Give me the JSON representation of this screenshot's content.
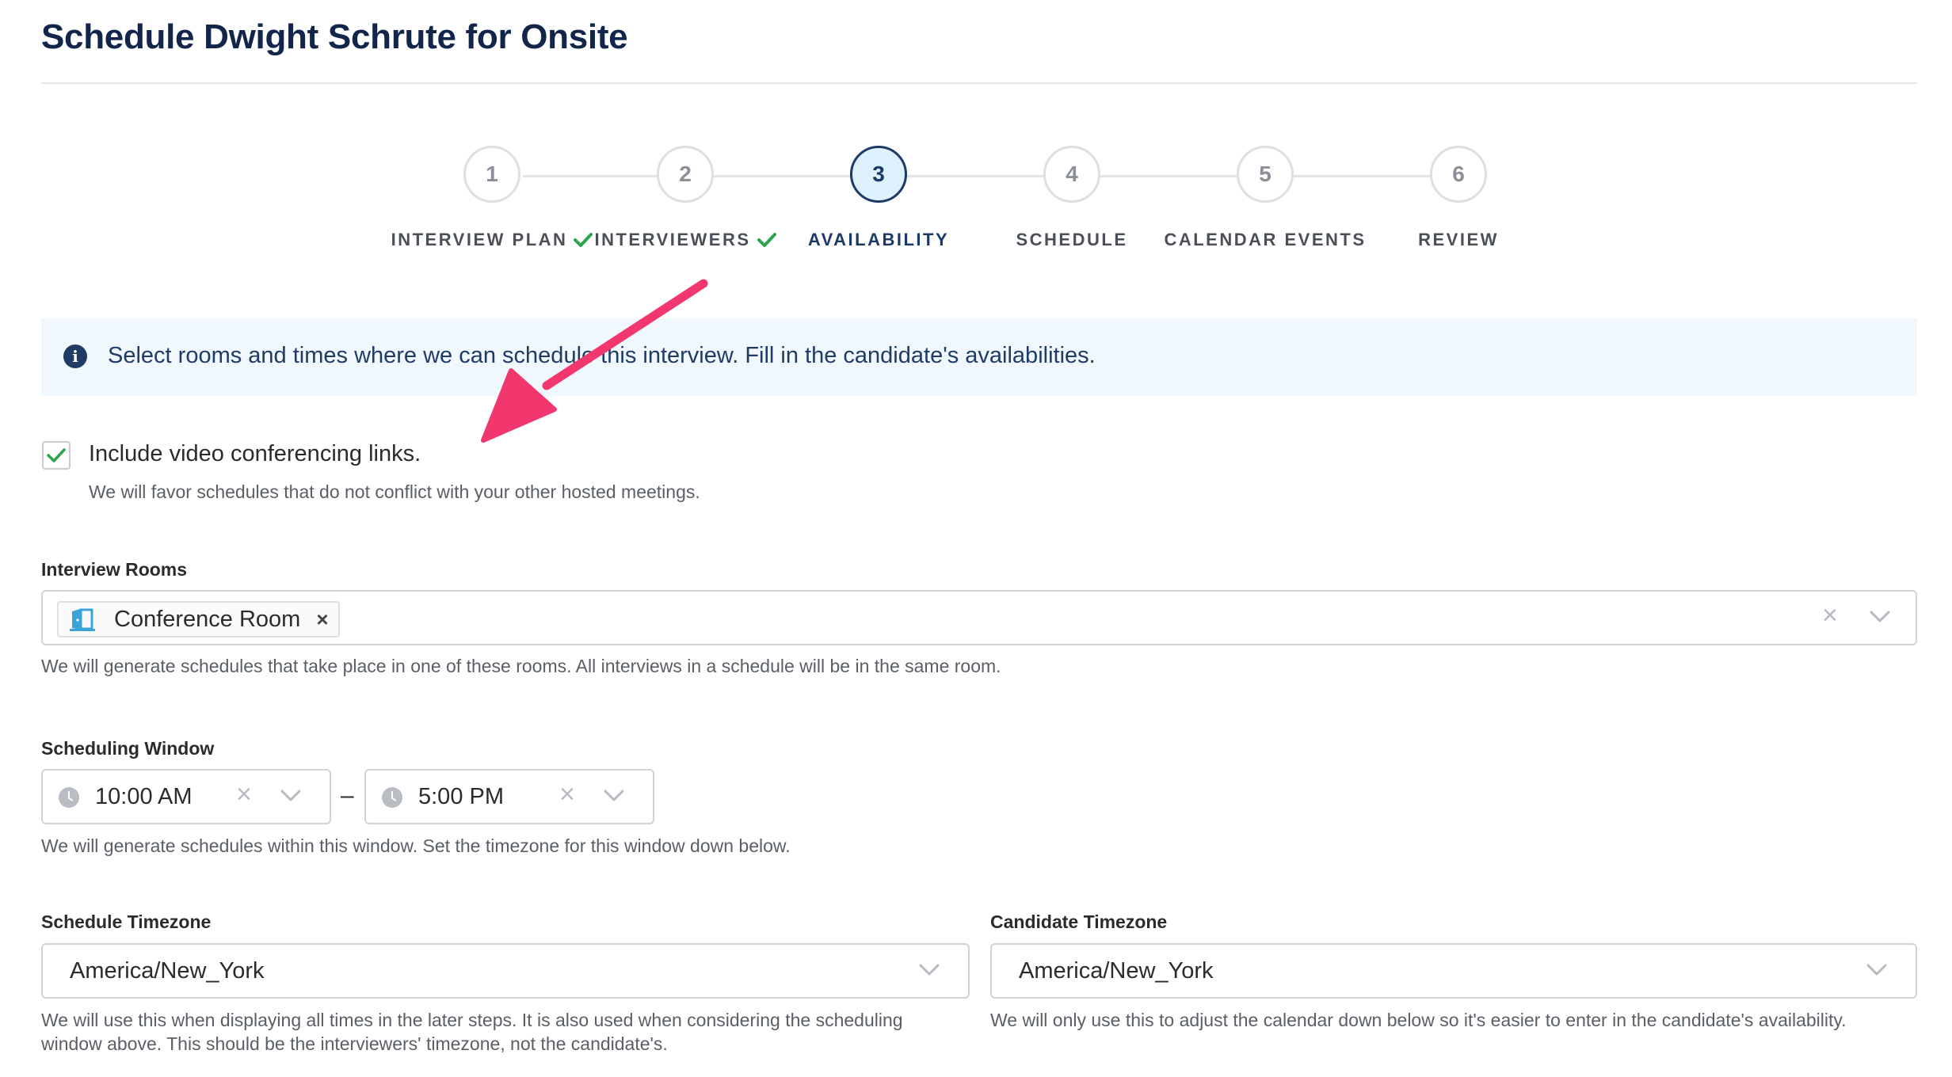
{
  "page": {
    "title": "Schedule Dwight Schrute for Onsite"
  },
  "stepper": {
    "steps": [
      {
        "number": "1",
        "label": "INTERVIEW PLAN",
        "completed": true,
        "active": false
      },
      {
        "number": "2",
        "label": "INTERVIEWERS",
        "completed": true,
        "active": false
      },
      {
        "number": "3",
        "label": "AVAILABILITY",
        "completed": false,
        "active": true
      },
      {
        "number": "4",
        "label": "SCHEDULE",
        "completed": false,
        "active": false
      },
      {
        "number": "5",
        "label": "CALENDAR EVENTS",
        "completed": false,
        "active": false
      },
      {
        "number": "6",
        "label": "REVIEW",
        "completed": false,
        "active": false
      }
    ]
  },
  "banner": {
    "icon": "info-icon",
    "text": "Select rooms and times where we can schedule this interview. Fill in the candidate's availabilities."
  },
  "video": {
    "checked": true,
    "label": "Include video conferencing links.",
    "help": "We will favor schedules that do not conflict with your other hosted meetings."
  },
  "rooms": {
    "label": "Interview Rooms",
    "selected": [
      {
        "name": "Conference Room",
        "icon": "door-icon"
      }
    ],
    "help": "We will generate schedules that take place in one of these rooms. All interviews in a schedule will be in the same room."
  },
  "window": {
    "label": "Scheduling Window",
    "start": "10:00 AM",
    "separator": "–",
    "end": "5:00 PM",
    "help": "We will generate schedules within this window. Set the timezone for this window down below."
  },
  "schedule_timezone": {
    "label": "Schedule Timezone",
    "value": "America/New_York",
    "help_line1": "We will use this when displaying all times in the later steps. It is also used when considering the scheduling",
    "help_line2": "window above. This should be the interviewers' timezone, not the candidate's."
  },
  "candidate_timezone": {
    "label": "Candidate Timezone",
    "value": "America/New_York",
    "help": "We will only use this to adjust the calendar down below so it's easier to enter in the candidate's availability."
  },
  "colors": {
    "navy": "#1b3a68",
    "check_green": "#2ea44f",
    "arrow_pink": "#f2376f",
    "banner_bg": "#f0f7fd"
  }
}
